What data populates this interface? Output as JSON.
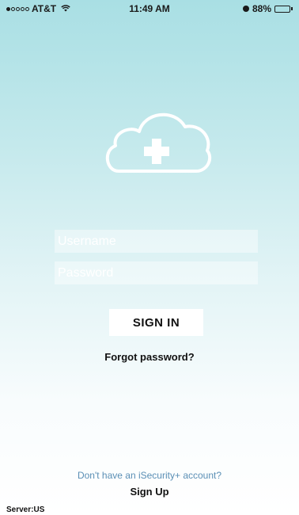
{
  "status_bar": {
    "carrier": "AT&T",
    "time": "11:49 AM",
    "battery_percent": "88%",
    "battery_level": 0.88,
    "signal_bars": 1,
    "icons": [
      "signal-dots-icon",
      "wifi-icon",
      "alarm-icon",
      "battery-icon"
    ]
  },
  "logo": {
    "icon": "cloud-plus-icon",
    "color": "#ffffff"
  },
  "login_form": {
    "username_placeholder": "Username",
    "username_value": "",
    "password_placeholder": "Password",
    "password_value": ""
  },
  "actions": {
    "sign_in_label": "SIGN IN",
    "forgot_password_label": "Forgot password?",
    "no_account_text": "Don't have an iSecurity+ account?",
    "sign_up_label": "Sign Up"
  },
  "footer": {
    "server_label": "Server:US"
  },
  "colors": {
    "background_top": "#a9dfe4",
    "background_bottom": "#ffffff",
    "link_blue": "#5a8fb5"
  }
}
